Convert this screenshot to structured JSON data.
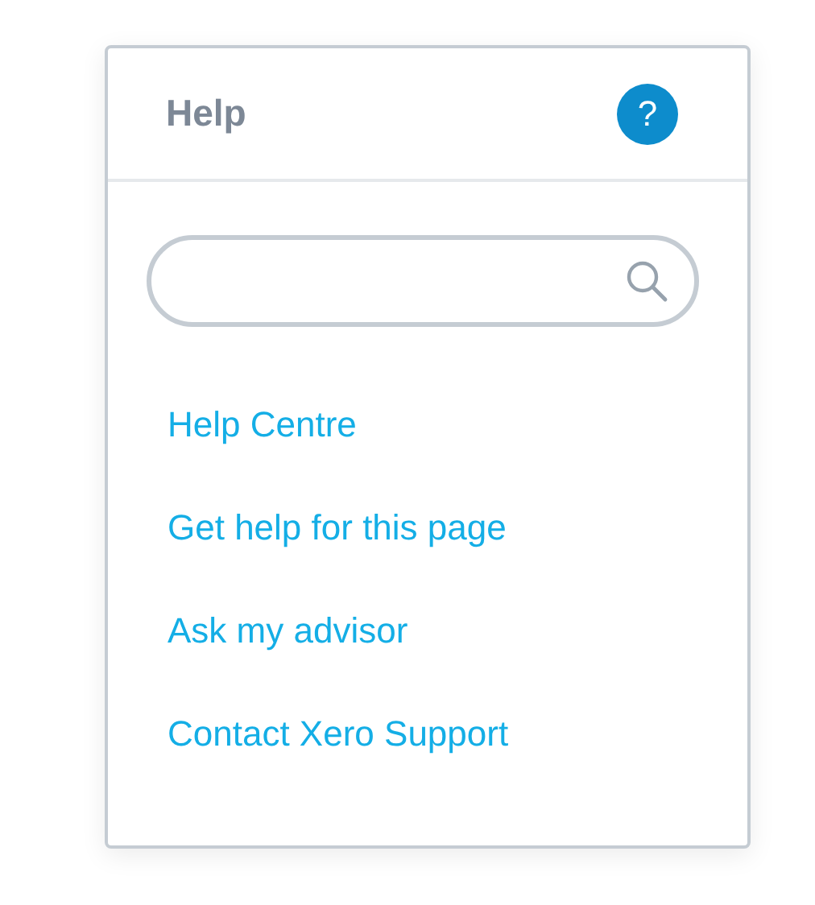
{
  "panel": {
    "title": "Help",
    "help_icon": "?"
  },
  "links": [
    {
      "label": "Help Centre"
    },
    {
      "label": "Get help for this page"
    },
    {
      "label": "Ask my advisor"
    },
    {
      "label": "Contact Xero Support"
    }
  ]
}
